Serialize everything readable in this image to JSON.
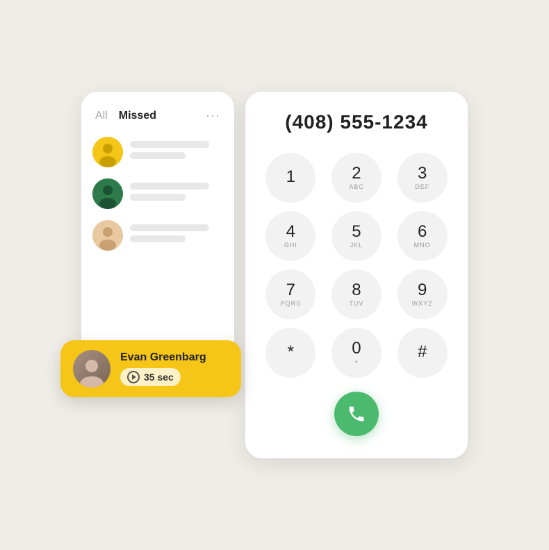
{
  "tabs": {
    "all": "All",
    "missed": "Missed",
    "more": "···"
  },
  "dialer": {
    "phone_number": "(408) 555-1234",
    "keys": [
      {
        "num": "1",
        "letters": ""
      },
      {
        "num": "2",
        "letters": "ABC"
      },
      {
        "num": "3",
        "letters": "DEF"
      },
      {
        "num": "4",
        "letters": "GHI"
      },
      {
        "num": "5",
        "letters": "JKL"
      },
      {
        "num": "6",
        "letters": "MNO"
      },
      {
        "num": "7",
        "letters": "PQRS"
      },
      {
        "num": "8",
        "letters": "TUV"
      },
      {
        "num": "9",
        "letters": "WXYZ"
      },
      {
        "num": "*",
        "letters": ""
      },
      {
        "num": "0",
        "letters": "+"
      },
      {
        "num": "#",
        "letters": ""
      }
    ]
  },
  "notification": {
    "name": "Evan Greenbarg",
    "duration": "35 sec",
    "duration_label": "35 sec"
  },
  "call_log": {
    "items": [
      {
        "avatar_color": "#f5c518"
      },
      {
        "avatar_color": "#2d7a4a"
      },
      {
        "avatar_color": "#e8c9a0"
      }
    ]
  }
}
